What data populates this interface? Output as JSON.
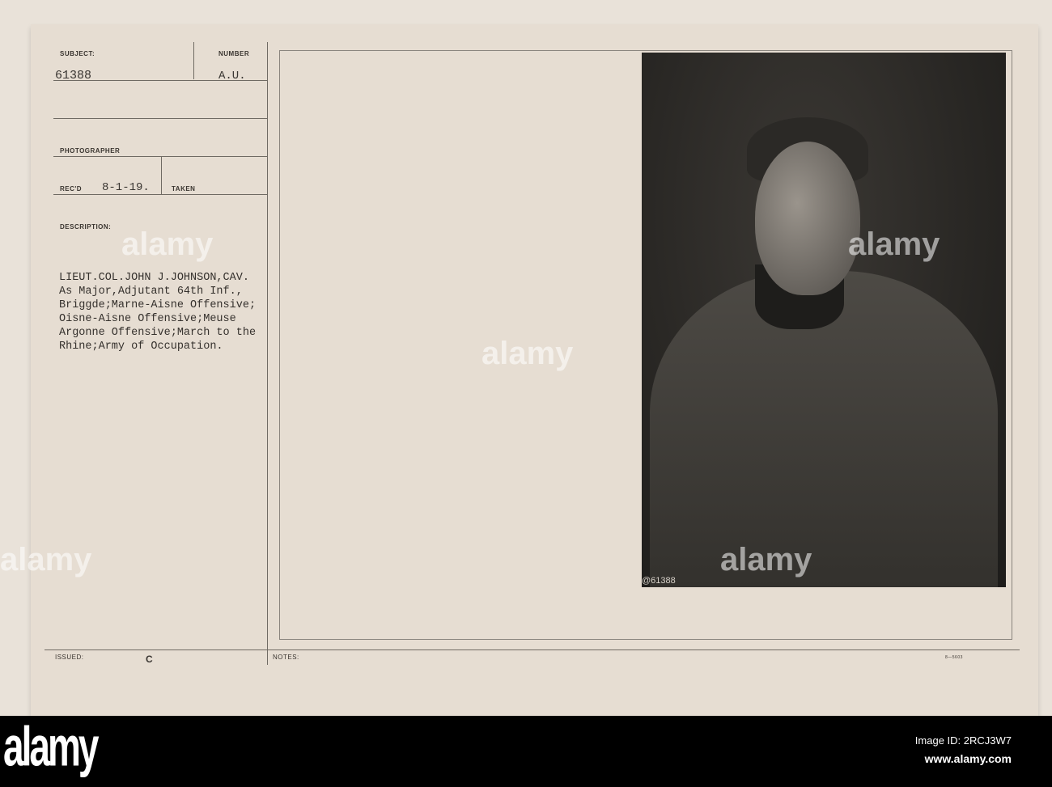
{
  "card": {
    "subject_label": "SUBJECT:",
    "subject_value": "61388",
    "number_label": "NUMBER",
    "number_value": "A.U.",
    "photographer_label": "PHOTOGRAPHER",
    "recd_label": "REC'D",
    "recd_value": "8-1-19.",
    "taken_label": "TAKEN",
    "description_label": "DESCRIPTION:",
    "description": "LIEUT.COL.JOHN J.JOHNSON,CAV.\nAs Major,Adjutant 64th Inf.,\nBriggde;Marne-Aisne Offensive;\nOisne-Aisne Offensive;Meuse\nArgonne Offensive;March to the\nRhine;Army of Occupation.",
    "issued_label": "ISSUED:",
    "issued_value": "C",
    "notes_label": "NOTES:",
    "form_code": "8—5603",
    "photo_number": "@61388"
  },
  "watermark": {
    "text": "alamy",
    "image_id": "Image ID: 2RCJ3W7",
    "url": "www.alamy.com"
  }
}
